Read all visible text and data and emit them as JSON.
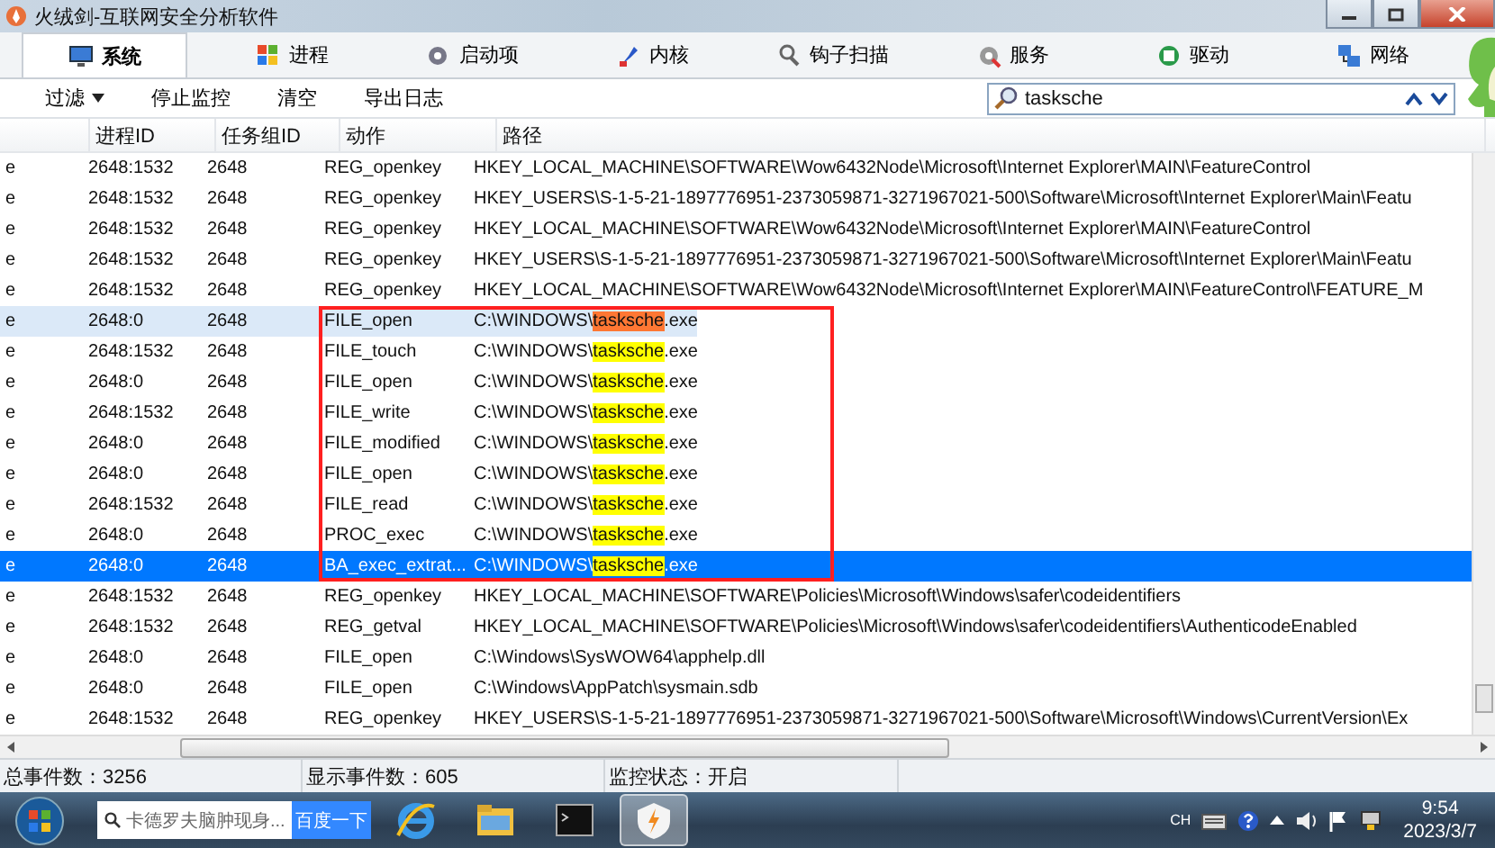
{
  "window": {
    "title": "火绒剑-互联网安全分析软件"
  },
  "tabs": [
    {
      "label": "系统",
      "selected": true
    },
    {
      "label": "进程",
      "selected": false
    },
    {
      "label": "启动项",
      "selected": false
    },
    {
      "label": "内核",
      "selected": false
    },
    {
      "label": "钩子扫描",
      "selected": false
    },
    {
      "label": "服务",
      "selected": false
    },
    {
      "label": "驱动",
      "selected": false
    },
    {
      "label": "网络",
      "selected": false
    }
  ],
  "toolbar": [
    {
      "label": "过滤",
      "kind": "dropdown"
    },
    {
      "label": "停止监控",
      "kind": "button"
    },
    {
      "label": "清空",
      "kind": "button"
    },
    {
      "label": "导出日志",
      "kind": "button"
    }
  ],
  "search": {
    "value": "tasksche"
  },
  "table": {
    "columns": [
      "进程ID",
      "任务组ID",
      "动作",
      "路径"
    ],
    "rows": [
      {
        "column_1": "e",
        "pid": "2648:1532",
        "group": "2648",
        "action": "REG_openkey",
        "path": [
          {
            "text": "HKEY_LOCAL_MACHINE\\SOFTWARE\\Wow6432Node\\Microsoft\\Internet Explorer\\MAIN\\FeatureControl",
            "kind": "plain"
          }
        ],
        "selected": false,
        "hot": false,
        "boxed": false
      },
      {
        "column_1": "e",
        "pid": "2648:1532",
        "group": "2648",
        "action": "REG_openkey",
        "path": [
          {
            "text": "HKEY_USERS\\S-1-5-21-1897776951-2373059871-3271967021-500\\Software\\Microsoft\\Internet Explorer\\Main\\Featu",
            "kind": "plain"
          }
        ],
        "selected": false,
        "hot": false,
        "boxed": false
      },
      {
        "column_1": "e",
        "pid": "2648:1532",
        "group": "2648",
        "action": "REG_openkey",
        "path": [
          {
            "text": "HKEY_LOCAL_MACHINE\\SOFTWARE\\Wow6432Node\\Microsoft\\Internet Explorer\\MAIN\\FeatureControl",
            "kind": "plain"
          }
        ],
        "selected": false,
        "hot": false,
        "boxed": false
      },
      {
        "column_1": "e",
        "pid": "2648:1532",
        "group": "2648",
        "action": "REG_openkey",
        "path": [
          {
            "text": "HKEY_USERS\\S-1-5-21-1897776951-2373059871-3271967021-500\\Software\\Microsoft\\Internet Explorer\\Main\\Featu",
            "kind": "plain"
          }
        ],
        "selected": false,
        "hot": false,
        "boxed": false
      },
      {
        "column_1": "e",
        "pid": "2648:1532",
        "group": "2648",
        "action": "REG_openkey",
        "path": [
          {
            "text": "HKEY_LOCAL_MACHINE\\SOFTWARE\\Wow6432Node\\Microsoft\\Internet Explorer\\MAIN\\FeatureControl\\FEATURE_M",
            "kind": "plain"
          }
        ],
        "selected": false,
        "hot": false,
        "boxed": false
      },
      {
        "column_1": "e",
        "pid": "2648:0",
        "group": "2648",
        "action": "FILE_open",
        "path": [
          {
            "text": "C:\\WINDOWS\\",
            "kind": "plain"
          },
          {
            "text": "tasksche",
            "kind": "current_match"
          },
          {
            "text": ".exe",
            "kind": "plain"
          }
        ],
        "selected": false,
        "hot": true,
        "boxed": true
      },
      {
        "column_1": "e",
        "pid": "2648:1532",
        "group": "2648",
        "action": "FILE_touch",
        "path": [
          {
            "text": "C:\\WINDOWS\\",
            "kind": "plain"
          },
          {
            "text": "tasksche",
            "kind": "match"
          },
          {
            "text": ".exe",
            "kind": "plain"
          }
        ],
        "selected": false,
        "hot": false,
        "boxed": true
      },
      {
        "column_1": "e",
        "pid": "2648:0",
        "group": "2648",
        "action": "FILE_open",
        "path": [
          {
            "text": "C:\\WINDOWS\\",
            "kind": "plain"
          },
          {
            "text": "tasksche",
            "kind": "match"
          },
          {
            "text": ".exe",
            "kind": "plain"
          }
        ],
        "selected": false,
        "hot": false,
        "boxed": true
      },
      {
        "column_1": "e",
        "pid": "2648:1532",
        "group": "2648",
        "action": "FILE_write",
        "path": [
          {
            "text": "C:\\WINDOWS\\",
            "kind": "plain"
          },
          {
            "text": "tasksche",
            "kind": "match"
          },
          {
            "text": ".exe",
            "kind": "plain"
          }
        ],
        "selected": false,
        "hot": false,
        "boxed": true
      },
      {
        "column_1": "e",
        "pid": "2648:0",
        "group": "2648",
        "action": "FILE_modified",
        "path": [
          {
            "text": "C:\\WINDOWS\\",
            "kind": "plain"
          },
          {
            "text": "tasksche",
            "kind": "match"
          },
          {
            "text": ".exe",
            "kind": "plain"
          }
        ],
        "selected": false,
        "hot": false,
        "boxed": true
      },
      {
        "column_1": "e",
        "pid": "2648:0",
        "group": "2648",
        "action": "FILE_open",
        "path": [
          {
            "text": "C:\\WINDOWS\\",
            "kind": "plain"
          },
          {
            "text": "tasksche",
            "kind": "match"
          },
          {
            "text": ".exe",
            "kind": "plain"
          }
        ],
        "selected": false,
        "hot": false,
        "boxed": true
      },
      {
        "column_1": "e",
        "pid": "2648:1532",
        "group": "2648",
        "action": "FILE_read",
        "path": [
          {
            "text": "C:\\WINDOWS\\",
            "kind": "plain"
          },
          {
            "text": "tasksche",
            "kind": "match"
          },
          {
            "text": ".exe",
            "kind": "plain"
          }
        ],
        "selected": false,
        "hot": false,
        "boxed": true
      },
      {
        "column_1": "e",
        "pid": "2648:0",
        "group": "2648",
        "action": "PROC_exec",
        "path": [
          {
            "text": "C:\\WINDOWS\\",
            "kind": "plain"
          },
          {
            "text": "tasksche",
            "kind": "match"
          },
          {
            "text": ".exe",
            "kind": "plain"
          }
        ],
        "selected": false,
        "hot": false,
        "boxed": true
      },
      {
        "column_1": "e",
        "pid": "2648:0",
        "group": "2648",
        "action": "BA_exec_extrat...",
        "path": [
          {
            "text": "C:\\WINDOWS\\",
            "kind": "plain"
          },
          {
            "text": "tasksche",
            "kind": "match"
          },
          {
            "text": ".exe",
            "kind": "plain"
          }
        ],
        "selected": true,
        "hot": false,
        "boxed": true
      },
      {
        "column_1": "e",
        "pid": "2648:1532",
        "group": "2648",
        "action": "REG_openkey",
        "path": [
          {
            "text": "HKEY_LOCAL_MACHINE\\SOFTWARE\\Policies\\Microsoft\\Windows\\safer\\codeidentifiers",
            "kind": "plain"
          }
        ],
        "selected": false,
        "hot": false,
        "boxed": false
      },
      {
        "column_1": "e",
        "pid": "2648:1532",
        "group": "2648",
        "action": "REG_getval",
        "path": [
          {
            "text": "HKEY_LOCAL_MACHINE\\SOFTWARE\\Policies\\Microsoft\\Windows\\safer\\codeidentifiers\\AuthenticodeEnabled",
            "kind": "plain"
          }
        ],
        "selected": false,
        "hot": false,
        "boxed": false
      },
      {
        "column_1": "e",
        "pid": "2648:0",
        "group": "2648",
        "action": "FILE_open",
        "path": [
          {
            "text": "C:\\Windows\\SysWOW64\\apphelp.dll",
            "kind": "plain"
          }
        ],
        "selected": false,
        "hot": false,
        "boxed": false
      },
      {
        "column_1": "e",
        "pid": "2648:0",
        "group": "2648",
        "action": "FILE_open",
        "path": [
          {
            "text": "C:\\Windows\\AppPatch\\sysmain.sdb",
            "kind": "plain"
          }
        ],
        "selected": false,
        "hot": false,
        "boxed": false
      },
      {
        "column_1": "e",
        "pid": "2648:1532",
        "group": "2648",
        "action": "REG_openkey",
        "path": [
          {
            "text": "HKEY_USERS\\S-1-5-21-1897776951-2373059871-3271967021-500\\Software\\Microsoft\\Windows\\CurrentVersion\\Ex",
            "kind": "plain"
          }
        ],
        "selected": false,
        "hot": false,
        "boxed": false
      }
    ]
  },
  "status_bar": [
    "总事件数：3256",
    "显示事件数：605",
    "监控状态：开启"
  ],
  "taskbar": {
    "search_placeholder": "卡德罗夫脑肿现身...",
    "search_button": "百度一下",
    "apps": [
      {
        "selected": false
      },
      {
        "selected": false
      },
      {
        "selected": false
      },
      {
        "selected": true
      }
    ],
    "tray_language": "CH",
    "time": "9:54",
    "date": "2023/3/7"
  }
}
